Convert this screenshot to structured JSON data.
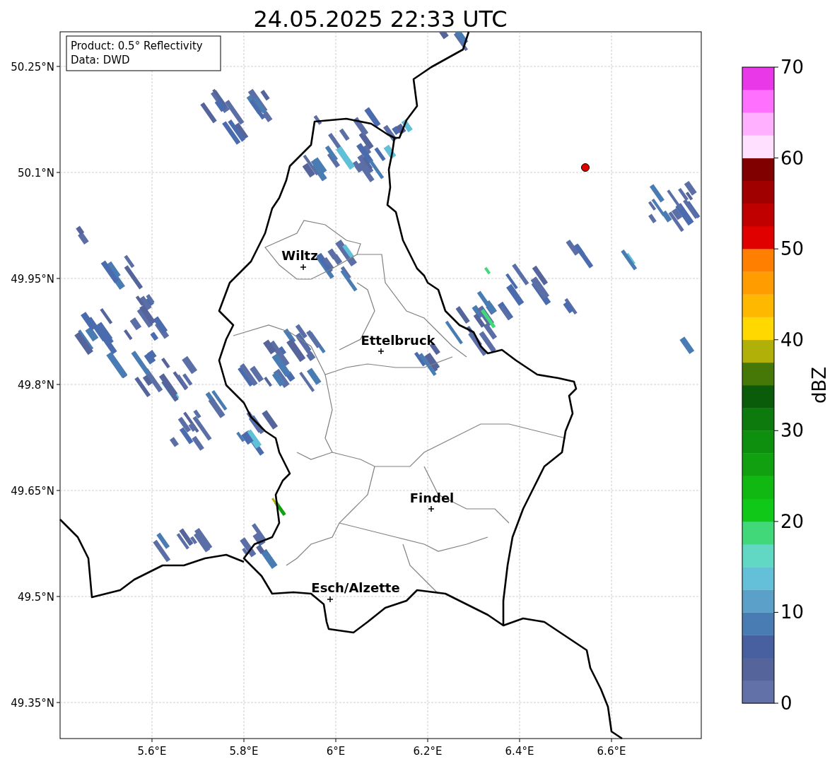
{
  "title": "24.05.2025 22:33 UTC",
  "info_box": {
    "lines": [
      "Product: 0.5° Reflectivity",
      "Data: DWD"
    ]
  },
  "map": {
    "cities": [
      {
        "label": "Wiltz"
      },
      {
        "label": "Ettelbruck"
      },
      {
        "label": "Findel"
      },
      {
        "label": "Esch/Alzette"
      }
    ],
    "yticks": [
      "50.25°N",
      "50.1°N",
      "49.95°N",
      "49.8°N",
      "49.65°N",
      "49.5°N",
      "49.35°N"
    ],
    "xticks": [
      "5.6°E",
      "5.8°E",
      "6°E",
      "6.2°E",
      "6.4°E",
      "6.6°E"
    ]
  },
  "colorbar": {
    "label": "dBZ",
    "ticks": [
      "70",
      "60",
      "50",
      "40",
      "30",
      "20",
      "10",
      "0"
    ],
    "bins": [
      {
        "color": "#6272a8"
      },
      {
        "color": "#56649c"
      },
      {
        "color": "#4860a0"
      },
      {
        "color": "#4a7cb4"
      },
      {
        "color": "#5aa0c8"
      },
      {
        "color": "#64c0d8"
      },
      {
        "color": "#60d8c4"
      },
      {
        "color": "#40d878"
      },
      {
        "color": "#10c818"
      },
      {
        "color": "#12b812"
      },
      {
        "color": "#10a010"
      },
      {
        "color": "#0e900e"
      },
      {
        "color": "#0c7a0c"
      },
      {
        "color": "#0a5c0a"
      },
      {
        "color": "#467808"
      },
      {
        "color": "#b0b008"
      },
      {
        "color": "#ffd800"
      },
      {
        "color": "#ffb800"
      },
      {
        "color": "#ff9c00"
      },
      {
        "color": "#ff8000"
      },
      {
        "color": "#e00000"
      },
      {
        "color": "#c00000"
      },
      {
        "color": "#a00000"
      },
      {
        "color": "#800000"
      },
      {
        "color": "#ffe0ff"
      },
      {
        "color": "#ffb0ff"
      },
      {
        "color": "#ff70ff"
      },
      {
        "color": "#e838e8"
      }
    ]
  }
}
